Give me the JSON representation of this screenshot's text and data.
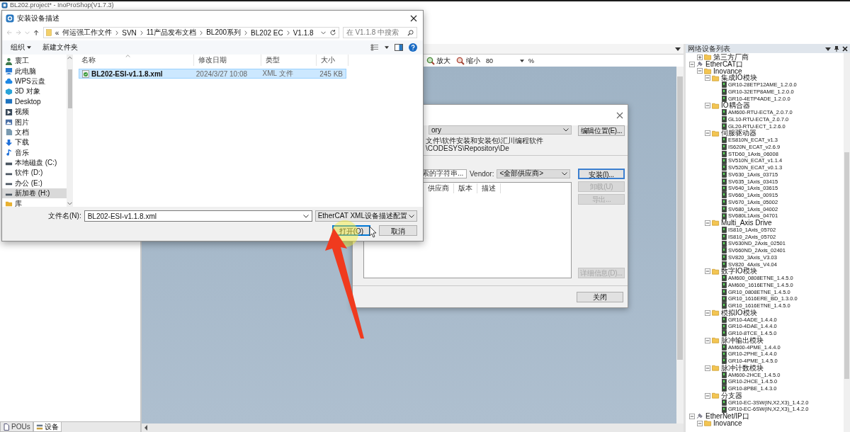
{
  "app": {
    "title": "BL202.project* - InoProShop(V1.7.3)"
  },
  "left_panel": {
    "tabs": [
      {
        "label": "POUs",
        "selected": false
      },
      {
        "label": "设备",
        "selected": true
      }
    ]
  },
  "editor_toolbar": {
    "zoom_in": "放大",
    "zoom_out": "缩小",
    "zoom_value": "80",
    "zoom_unit": "%"
  },
  "device_panel": {
    "title": "网络设备列表",
    "partial_above": [
      {
        "label": "第三方厂商",
        "kind": "folder",
        "expanded": false
      }
    ],
    "tree": [
      {
        "label": "EtherCAT口",
        "kind": "port",
        "expanded": true,
        "children": [
          {
            "label": "Inovance",
            "kind": "folder",
            "expanded": true,
            "children": [
              {
                "label": "集成IO模块",
                "kind": "folder",
                "expanded": true,
                "children": [
                  {
                    "label": "GR10-28ETP12AME_1.2.0.0",
                    "kind": "device"
                  },
                  {
                    "label": "GR10-32ETP8AME_1.2.0.0",
                    "kind": "device"
                  },
                  {
                    "label": "GR10-4ETP4ADE_1.2.0.0",
                    "kind": "device"
                  }
                ]
              },
              {
                "label": "IO耦合器",
                "kind": "folder",
                "expanded": true,
                "children": [
                  {
                    "label": "AM600-RTU-ECTA_2.0.7.0",
                    "kind": "device"
                  },
                  {
                    "label": "GL10-RTU-ECTA_2.0.7.0",
                    "kind": "device"
                  },
                  {
                    "label": "GL20-RTU-ECT_1.2.6.0",
                    "kind": "device"
                  }
                ]
              },
              {
                "label": "伺服驱动器",
                "kind": "folder",
                "expanded": true,
                "children": [
                  {
                    "label": "ES810N_ECAT_v1.3",
                    "kind": "device"
                  },
                  {
                    "label": "IS620N_ECAT_v2.6.9",
                    "kind": "device"
                  },
                  {
                    "label": "STD60_1Axis_06008",
                    "kind": "device"
                  },
                  {
                    "label": "SV510N_ECAT_v1.1.4",
                    "kind": "device"
                  },
                  {
                    "label": "SV520N_ECAT_v0.1.3",
                    "kind": "device"
                  },
                  {
                    "label": "SV630_1Axis_03715",
                    "kind": "device"
                  },
                  {
                    "label": "SV635_1Axis_03415",
                    "kind": "device"
                  },
                  {
                    "label": "SV640_1Axis_03615",
                    "kind": "device"
                  },
                  {
                    "label": "SV660_1Axis_00915",
                    "kind": "device"
                  },
                  {
                    "label": "SV670_1Axis_05002",
                    "kind": "device"
                  },
                  {
                    "label": "SV680_1Axis_04002",
                    "kind": "device"
                  },
                  {
                    "label": "SV680L1Axis_04701",
                    "kind": "device"
                  }
                ]
              },
              {
                "label": "Multi_Axis Drive",
                "kind": "folder",
                "expanded": true,
                "children": [
                  {
                    "label": "IS810_1Axis_05702",
                    "kind": "device"
                  },
                  {
                    "label": "IS810_2Axis_05702",
                    "kind": "device"
                  },
                  {
                    "label": "SV630ND_2Axis_02501",
                    "kind": "device"
                  },
                  {
                    "label": "SV660ND_2Axis_02401",
                    "kind": "device"
                  },
                  {
                    "label": "SV820_3Axis_V3.03",
                    "kind": "device"
                  },
                  {
                    "label": "SV820_4Axis_V4.04",
                    "kind": "device"
                  }
                ]
              },
              {
                "label": "数字IO模块",
                "kind": "folder",
                "expanded": true,
                "children": [
                  {
                    "label": "AM600_0808ETNE_1.4.5.0",
                    "kind": "device"
                  },
                  {
                    "label": "AM600_1616ETNE_1.4.5.0",
                    "kind": "device"
                  },
                  {
                    "label": "GR10_0808ETNE_1.4.5.0",
                    "kind": "device"
                  },
                  {
                    "label": "GR10_1616ERE_BD_1.3.0.0",
                    "kind": "device"
                  },
                  {
                    "label": "GR10_1616ETNE_1.4.5.0",
                    "kind": "device"
                  }
                ]
              },
              {
                "label": "模拟IO模块",
                "kind": "folder",
                "expanded": true,
                "children": [
                  {
                    "label": "GR10-4ADE_1.4.4.0",
                    "kind": "device"
                  },
                  {
                    "label": "GR10-4DAE_1.4.4.0",
                    "kind": "device"
                  },
                  {
                    "label": "GR10-8TCE_1.4.5.0",
                    "kind": "device"
                  }
                ]
              },
              {
                "label": "脉冲输出模块",
                "kind": "folder",
                "expanded": true,
                "children": [
                  {
                    "label": "AM600-4PME_1.4.4.0",
                    "kind": "device"
                  },
                  {
                    "label": "GR10-2PHE_1.4.4.0",
                    "kind": "device"
                  },
                  {
                    "label": "GR10-4PME_1.4.5.0",
                    "kind": "device"
                  }
                ]
              },
              {
                "label": "脉冲计数模块",
                "kind": "folder",
                "expanded": true,
                "children": [
                  {
                    "label": "AM600-2HCE_1.4.5.0",
                    "kind": "device"
                  },
                  {
                    "label": "GR10-2HCE_1.4.5.0",
                    "kind": "device"
                  },
                  {
                    "label": "GR10-8PBE_1.4.3.0",
                    "kind": "device"
                  }
                ]
              },
              {
                "label": "分支器",
                "kind": "folder",
                "expanded": true,
                "children": [
                  {
                    "label": "GR10-EC-3SW(IN,X2,X3)_1.4.2.0",
                    "kind": "device"
                  },
                  {
                    "label": "GR10-EC-6SW(IN,X2,X3)_1.4.2.0",
                    "kind": "device"
                  }
                ]
              }
            ]
          }
        ]
      },
      {
        "label": "EtherNet/IP口",
        "kind": "port",
        "expanded": true,
        "children": [
          {
            "label": "Inovance",
            "kind": "folder",
            "expanded": true
          }
        ]
      }
    ]
  },
  "repo_dialog": {
    "repository": "ory",
    "path": "文件\\软件安装和安装包\\汇川编程软件\\CODESYS\\Repository\\De",
    "edit_button": "编辑位置(E)...",
    "search_placeholder": "索的字符串...",
    "vendor_label": "Vendor:",
    "vendor_value": "<全部供应商>",
    "columns": [
      "供应商",
      "版本",
      "描述"
    ],
    "buttons": [
      {
        "label": "安装(I)...",
        "disabled": false
      },
      {
        "label": "卸载(U)",
        "disabled": true
      },
      {
        "label": "导出...",
        "disabled": true
      },
      {
        "label": "详细信息(D)...",
        "disabled": true
      }
    ],
    "close_button": "关闭"
  },
  "file_dialog": {
    "title": "安装设备描述",
    "path_overflow": "«",
    "path": [
      "何运强工作文件",
      "SVN",
      "11产品发布文档",
      "BL200系列",
      "BL202 EC",
      "V1.1.8"
    ],
    "search_placeholder": "在 V1.1.8 中搜索",
    "organize": "组织",
    "new_folder": "新建文件夹",
    "nav": [
      {
        "label": "寰工",
        "kind": "user",
        "selected": false
      },
      {
        "label": "此电脑",
        "kind": "pc",
        "selected": false
      },
      {
        "label": "WPS云盘",
        "kind": "cloud",
        "selected": false
      },
      {
        "label": "3D 对象",
        "kind": "cube",
        "selected": false
      },
      {
        "label": "Desktop",
        "kind": "desktop",
        "selected": false
      },
      {
        "label": "视频",
        "kind": "video",
        "selected": false
      },
      {
        "label": "图片",
        "kind": "picture",
        "selected": false
      },
      {
        "label": "文档",
        "kind": "doc",
        "selected": false
      },
      {
        "label": "下载",
        "kind": "download",
        "selected": false
      },
      {
        "label": "音乐",
        "kind": "music",
        "selected": false
      },
      {
        "label": "本地磁盘 (C:)",
        "kind": "disk",
        "selected": false
      },
      {
        "label": "软件 (D:)",
        "kind": "drive",
        "selected": false
      },
      {
        "label": "办公 (E:)",
        "kind": "drive",
        "selected": false
      },
      {
        "label": "新加卷 (H:)",
        "kind": "drive",
        "selected": true
      },
      {
        "label": "库",
        "kind": "library",
        "selected": false
      }
    ],
    "columns": [
      "名称",
      "修改日期",
      "类型",
      "大小"
    ],
    "files": [
      {
        "name": "BL202-ESI-v1.1.8.xml",
        "date": "2024/3/27 10:08",
        "type": "XML 文件",
        "size": "245 KB",
        "selected": true
      }
    ],
    "filename_label": "文件名(N):",
    "filename": "BL202-ESI-v1.1.8.xml",
    "filter": "EtherCAT XML设备描述配置",
    "open_button": "打开(O)",
    "cancel_button": "取消"
  }
}
